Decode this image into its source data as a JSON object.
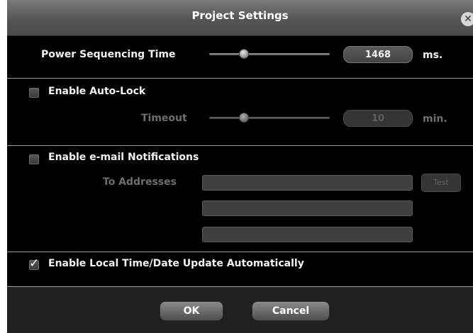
{
  "dialog": {
    "title": "Project Settings",
    "close_icon": "close-icon"
  },
  "power_sequencing": {
    "label": "Power Sequencing Time",
    "value": "1468",
    "unit": "ms.",
    "slider_level": 0.29
  },
  "auto_lock": {
    "checkbox_label": "Enable Auto-Lock",
    "checked": false,
    "timeout_label": "Timeout",
    "timeout_value": "10",
    "timeout_unit": "min.",
    "slider_level": 0.29
  },
  "email": {
    "checkbox_label": "Enable e-mail Notifications",
    "checked": false,
    "to_label": "To Addresses",
    "addresses": [
      "",
      "",
      ""
    ],
    "test_label": "Test"
  },
  "time_date": {
    "checkbox_label": "Enable Local Time/Date Update Automatically",
    "checked": true
  },
  "buttons": {
    "ok_label": "OK",
    "cancel_label": "Cancel"
  }
}
